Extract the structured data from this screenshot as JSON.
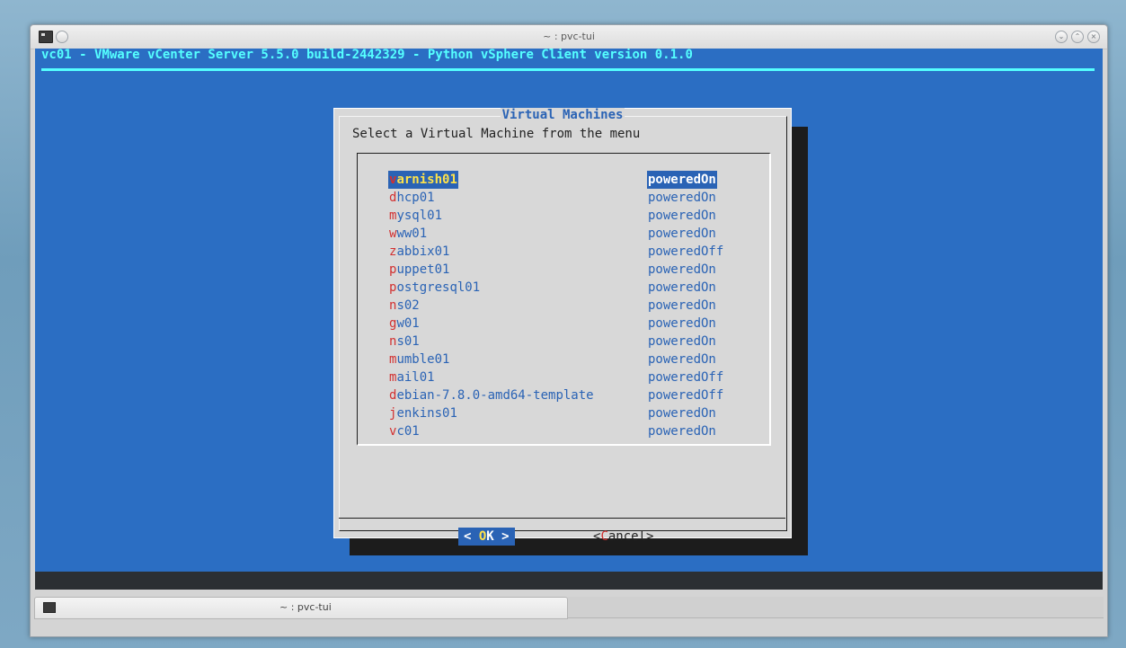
{
  "window": {
    "title": "~ : pvc-tui"
  },
  "terminal": {
    "header": "vc01 - VMware vCenter Server 5.5.0 build-2442329 - Python vSphere Client version 0.1.0"
  },
  "dialog": {
    "title": "Virtual Machines",
    "prompt": "Select a Virtual Machine from the menu",
    "vms": [
      {
        "hot": "v",
        "rest": "arnish01",
        "state": "poweredOn",
        "selected": true
      },
      {
        "hot": "d",
        "rest": "hcp01",
        "state": "poweredOn"
      },
      {
        "hot": "m",
        "rest": "ysql01",
        "state": "poweredOn"
      },
      {
        "hot": "w",
        "rest": "ww01",
        "state": "poweredOn"
      },
      {
        "hot": "z",
        "rest": "abbix01",
        "state": "poweredOff"
      },
      {
        "hot": "p",
        "rest": "uppet01",
        "state": "poweredOn"
      },
      {
        "hot": "p",
        "rest": "ostgresql01",
        "state": "poweredOn"
      },
      {
        "hot": "n",
        "rest": "s02",
        "state": "poweredOn"
      },
      {
        "hot": "g",
        "rest": "w01",
        "state": "poweredOn"
      },
      {
        "hot": "n",
        "rest": "s01",
        "state": "poweredOn"
      },
      {
        "hot": "m",
        "rest": "umble01",
        "state": "poweredOn"
      },
      {
        "hot": "m",
        "rest": "ail01",
        "state": "poweredOff"
      },
      {
        "hot": "d",
        "rest": "ebian-7.8.0-amd64-template",
        "state": "poweredOff"
      },
      {
        "hot": "j",
        "rest": "enkins01",
        "state": "poweredOn"
      },
      {
        "hot": "v",
        "rest": "c01",
        "state": "poweredOn"
      }
    ],
    "ok_button": {
      "left": "< ",
      "hot": "O",
      "rest": "K",
      "right": " >"
    },
    "cancel_button": {
      "left": "<",
      "hot": "C",
      "rest": "ancel",
      "right": ">"
    }
  },
  "taskbar": {
    "task_label": "~ : pvc-tui"
  },
  "icons": [
    "terminal-icon",
    "minimize-icon",
    "maximize-icon",
    "close-icon",
    "keep-above-icon"
  ]
}
